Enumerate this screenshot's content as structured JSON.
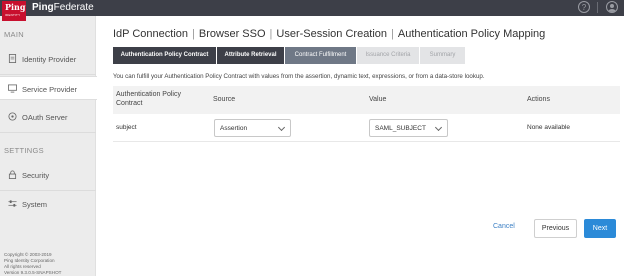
{
  "brand": {
    "logo_text": "Ping",
    "logo_sub": "IDENTITY",
    "name_bold": "Ping",
    "name_thin": "Federate"
  },
  "topbar": {
    "help_icon": "question-circle-icon",
    "user_icon": "user-circle-icon"
  },
  "sidebar": {
    "main_label": "MAIN",
    "settings_label": "SETTINGS",
    "items": [
      {
        "label": "Identity Provider",
        "icon": "document-icon",
        "active": false
      },
      {
        "label": "Service Provider",
        "icon": "monitor-icon",
        "active": true
      },
      {
        "label": "OAuth Server",
        "icon": "circle-icon",
        "active": false
      },
      {
        "label": "Security",
        "icon": "lock-icon",
        "active": false
      },
      {
        "label": "System",
        "icon": "sliders-icon",
        "active": false
      }
    ],
    "footer": [
      "Copyright © 2003-2019",
      "Ping Identity Corporation",
      "All rights reserved",
      "Version 9.3.0.5-SNAPSHOT"
    ]
  },
  "breadcrumb": [
    "IdP Connection",
    "Browser SSO",
    "User-Session Creation",
    "Authentication Policy Mapping"
  ],
  "tabs": [
    {
      "label": "Authentication Policy Contract",
      "state": "done"
    },
    {
      "label": "Attribute Retrieval",
      "state": "done"
    },
    {
      "label": "Contract Fulfillment",
      "state": "current"
    },
    {
      "label": "Issuance Criteria",
      "state": "future"
    },
    {
      "label": "Summary",
      "state": "future"
    }
  ],
  "description": "You can fulfill your Authentication Policy Contract with values from the assertion, dynamic text, expressions, or from a data-store lookup.",
  "table": {
    "headers": {
      "contract_line1": "Authentication Policy",
      "contract_line2": "Contract",
      "source": "Source",
      "value": "Value",
      "actions": "Actions"
    },
    "rows": [
      {
        "contract": "subject",
        "source": "Assertion",
        "value": "SAML_SUBJECT",
        "actions": "None available"
      }
    ]
  },
  "buttons": {
    "cancel": "Cancel",
    "previous": "Previous",
    "next": "Next"
  },
  "colors": {
    "accent": "#2b8ad8",
    "topbar": "#3d3f48",
    "logo": "#c8102e",
    "tab_current": "#6f7886"
  }
}
